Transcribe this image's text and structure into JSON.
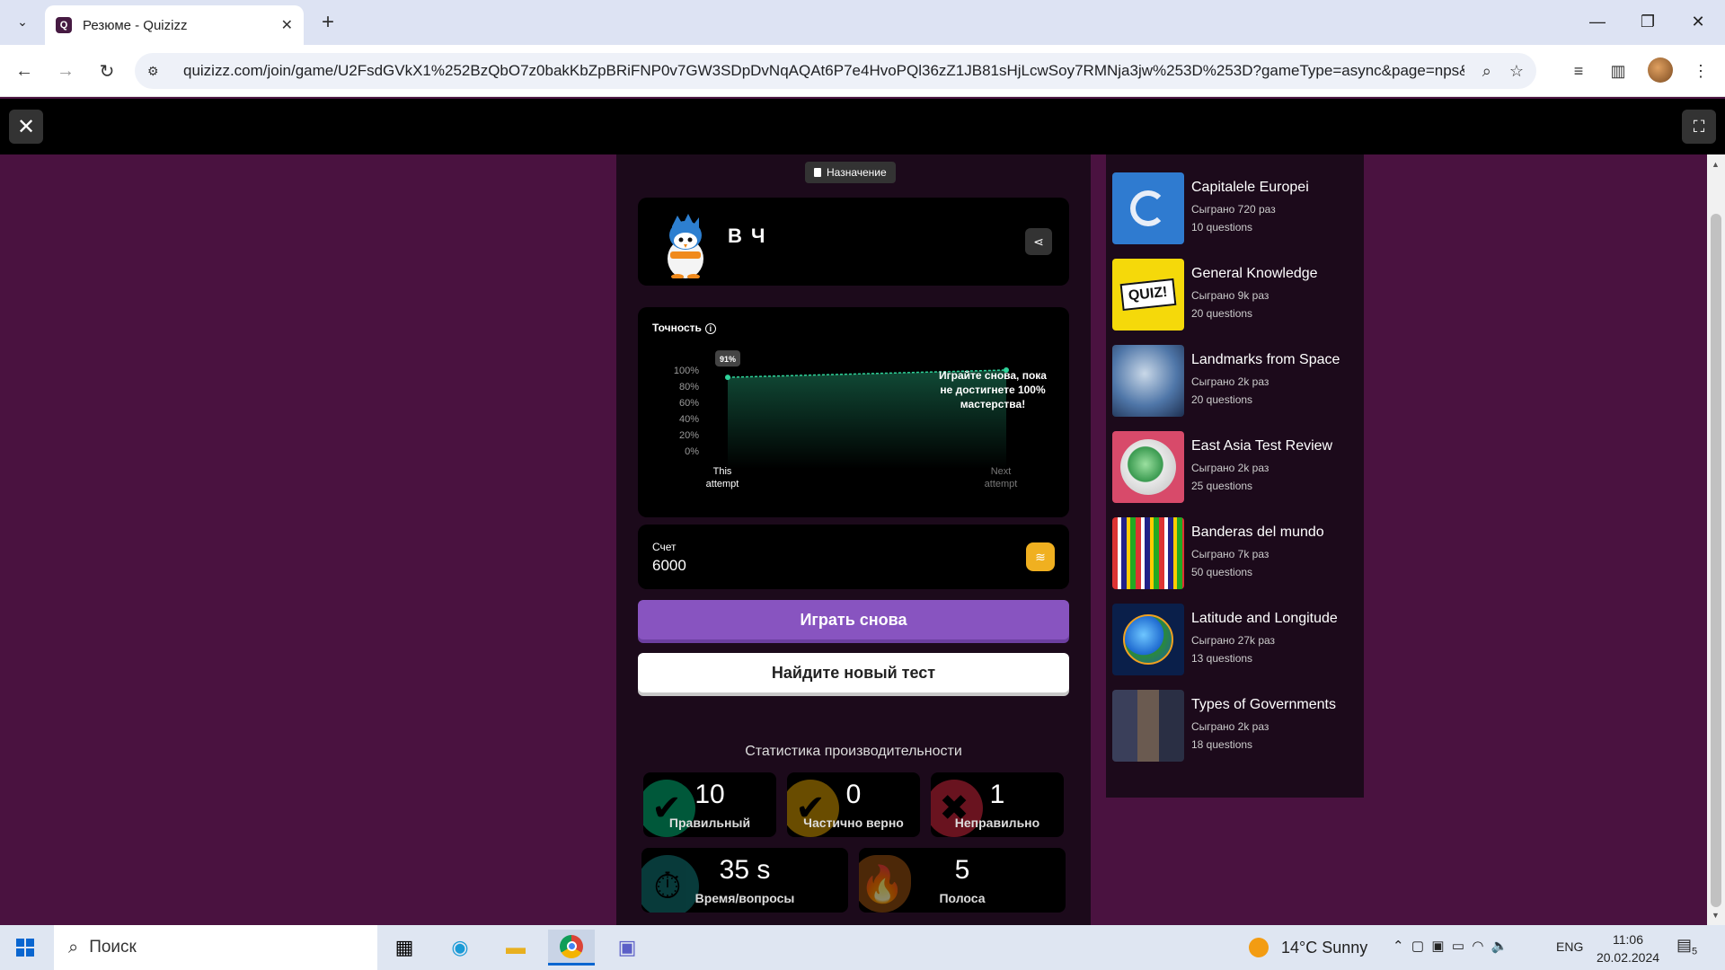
{
  "browser": {
    "tab_title": "Резюме - Quizizz",
    "favicon_letter": "Q",
    "url": "quizizz.com/join/game/U2FsdGVkX1%252BzQbO7z0bakKbZpBRiFNP0v7GW3SDpDvNqAQAt6P7e4HvoPQl36zZ1JB81sHjLcwSoy7RMNja3jw%253D%253D?gameType=async&page=nps&..."
  },
  "game": {
    "tag": "Назначение",
    "player_name": "В Ч",
    "accuracy_title": "Точность",
    "accuracy_message": "Играйте снова, пока не достигнете 100% мастерства!",
    "score_label": "Счет",
    "score_value": "6000",
    "play_again": "Играть снова",
    "find_new": "Найдите новый тест",
    "stats_title": "Статистика производительности",
    "stats": {
      "correct": {
        "value": "10",
        "label": "Правильный"
      },
      "partial": {
        "value": "0",
        "label": "Частично верно"
      },
      "incorrect": {
        "value": "1",
        "label": "Неправильно"
      },
      "time": {
        "value": "35 s",
        "label": "Время/вопросы"
      },
      "streak": {
        "value": "5",
        "label": "Полоса"
      }
    }
  },
  "chart_data": {
    "type": "line",
    "title": "Точность",
    "categories": [
      "This attempt",
      "Next attempt"
    ],
    "series": [
      {
        "values": [
          91,
          100
        ]
      }
    ],
    "point_label": "91%",
    "yticks": [
      "100%",
      "80%",
      "60%",
      "40%",
      "20%",
      "0%"
    ],
    "ylim": [
      0,
      100
    ],
    "colors": {
      "line": "#2fd39a"
    }
  },
  "recommendations": [
    {
      "title": "Capitalele Europei",
      "plays": "Сыграно 720 раз",
      "questions": "10 questions"
    },
    {
      "title": "General Knowledge",
      "plays": "Сыграно 9k раз",
      "questions": "20 questions"
    },
    {
      "title": "Landmarks from Space",
      "plays": "Сыграно 2k раз",
      "questions": "20 questions"
    },
    {
      "title": "East Asia Test Review",
      "plays": "Сыграно 2k раз",
      "questions": "25 questions"
    },
    {
      "title": "Banderas del mundo",
      "plays": "Сыграно 7k раз",
      "questions": "50 questions"
    },
    {
      "title": "Latitude and Longitude",
      "plays": "Сыграно 27k раз",
      "questions": "13 questions"
    },
    {
      "title": "Types of Governments",
      "plays": "Сыграно 2k раз",
      "questions": "18 questions"
    }
  ],
  "taskbar": {
    "search_placeholder": "Поиск",
    "weather": "14°C  Sunny",
    "lang": "ENG",
    "time": "11:06",
    "date": "20.02.2024",
    "notifications": "5"
  },
  "colors": {
    "page_bg": "#4a1240",
    "panel_bg": "#1c0a1b",
    "primary": "#8854c0",
    "correct": "#00a06a",
    "partial": "#c08a00",
    "incorrect": "#c0233a"
  }
}
